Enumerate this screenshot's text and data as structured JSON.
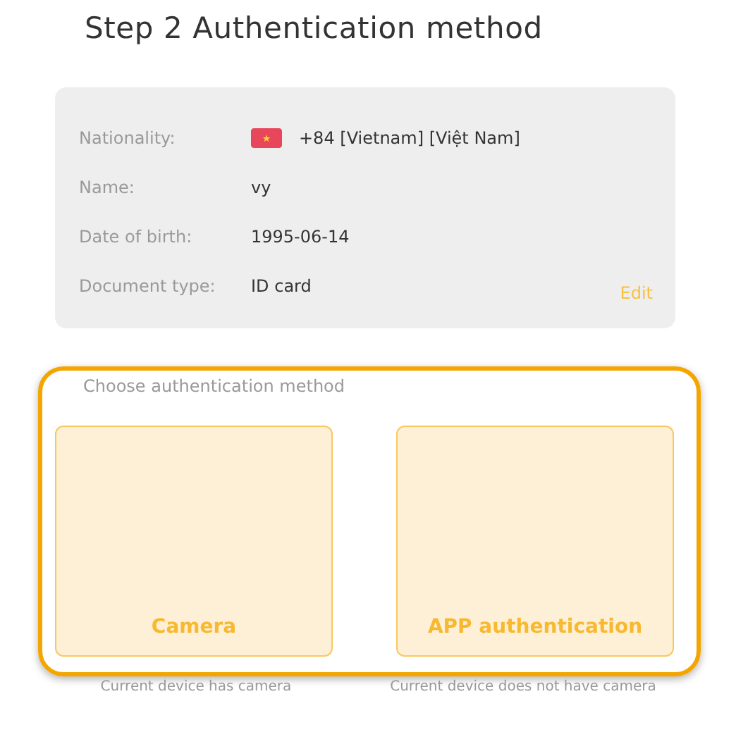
{
  "title": "Step 2 Authentication method",
  "details": {
    "rows": [
      {
        "label": "Nationality:",
        "value": "+84 [Vietnam] [Việt Nam]",
        "kind": "flag"
      },
      {
        "label": "Name:",
        "value": "vy",
        "kind": "text"
      },
      {
        "label": "Date of birth:",
        "value": "1995-06-14",
        "kind": "text"
      },
      {
        "label": "Document type:",
        "value": "ID card",
        "kind": "text"
      }
    ],
    "edit_link": "Edit"
  },
  "methods": {
    "heading": "Choose authentication method",
    "highlighted": true,
    "options": [
      {
        "label": "Camera",
        "caption": "Current device has camera"
      },
      {
        "label": "APP authentication",
        "caption": "Current device does not have camera"
      }
    ]
  }
}
